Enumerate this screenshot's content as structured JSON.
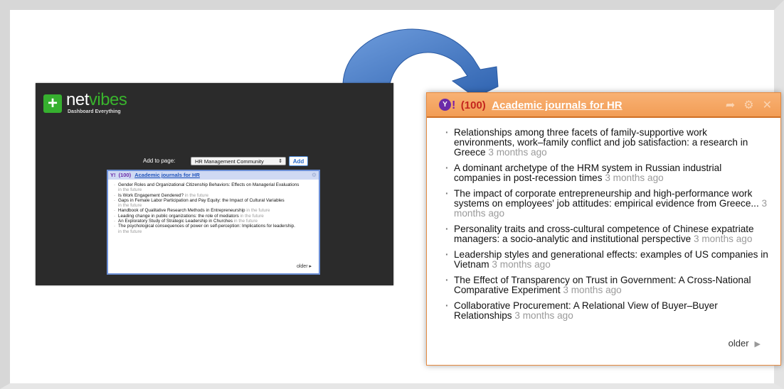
{
  "left": {
    "brand_a": "net",
    "brand_b": "vibes",
    "tagline": "Dashboard Everything",
    "add_label": "Add to page:",
    "select_value": "HR Management Community",
    "add_button": "Add",
    "widget": {
      "icon": "Y!",
      "count": "(100)",
      "title": "Academic journals for HR",
      "items": [
        {
          "text": "Gender Roles and Organizational Citizenship Behaviors: Effects on Managerial Evaluations",
          "meta": "in the future"
        },
        {
          "text": "Is Work Engagement Gendered?",
          "meta": "in the future"
        },
        {
          "text": "Gaps in Female Labor Participation and Pay Equity: the Impact of Cultural Variables",
          "meta": "in the future"
        },
        {
          "text": "Handbook of Qualitative Research Methods in Entrepreneurship",
          "meta": "in the future"
        },
        {
          "text": "Leading change in public organizations: the role of mediators",
          "meta": "in the future"
        },
        {
          "text": "An Exploratory Study of Strategic Leadership in Churches",
          "meta": "in the future"
        },
        {
          "text": "The psychological consequences of power on self-perception: Implications for leadership.",
          "meta": "in the future"
        }
      ],
      "older": "older ▸"
    }
  },
  "right": {
    "count": "(100)",
    "title": "Academic journals for HR",
    "items": [
      {
        "text": "Relationships among three facets of family-supportive work environments, work–family conflict and job satisfaction: a research in Greece",
        "meta": "3 months ago"
      },
      {
        "text": "A dominant archetype of the HRM system in Russian industrial companies in post-recession times",
        "meta": "3 months ago"
      },
      {
        "text": "The impact of corporate entrepreneurship and high-performance work systems on employees' job attitudes: empirical evidence from Greece...",
        "meta": "3 months ago"
      },
      {
        "text": "Personality traits and cross-cultural competence of Chinese expatriate managers: a socio-analytic and institutional perspective",
        "meta": "3 months ago"
      },
      {
        "text": "Leadership styles and generational effects: examples of US companies in Vietnam",
        "meta": "3 months ago"
      },
      {
        "text": "The Effect of Transparency on Trust in Government: A Cross-National Comparative Experiment",
        "meta": "3 months ago"
      },
      {
        "text": "Collaborative Procurement: A Relational View of Buyer–Buyer Relationships",
        "meta": "3 months ago"
      }
    ],
    "older": "older"
  }
}
